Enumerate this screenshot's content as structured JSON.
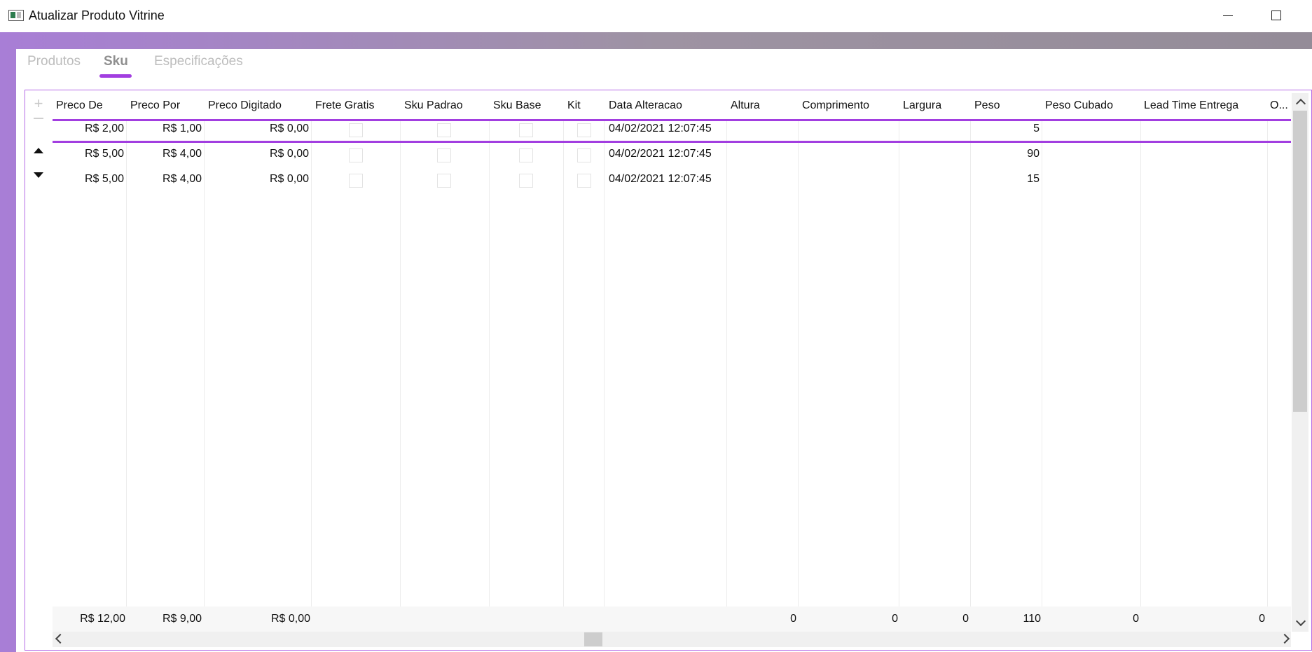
{
  "window": {
    "title": "Atualizar Produto Vitrine"
  },
  "tabs": [
    {
      "label": "Produtos",
      "active": false
    },
    {
      "label": "Sku",
      "active": true
    },
    {
      "label": "Especificações",
      "active": false
    }
  ],
  "grid": {
    "columns": [
      "Preco De",
      "Preco Por",
      "Preco Digitado",
      "Frete Gratis",
      "Sku Padrao",
      "Sku Base",
      "Kit",
      "Data Alteracao",
      "Altura",
      "Comprimento",
      "Largura",
      "Peso",
      "Peso Cubado",
      "Lead Time Entrega",
      "O..."
    ],
    "rows": [
      {
        "preco_de": "R$ 2,00",
        "preco_por": "R$ 1,00",
        "preco_digitado": "R$ 0,00",
        "frete_gratis": false,
        "sku_padrao": false,
        "sku_base": false,
        "kit": false,
        "data_alteracao": "04/02/2021 12:07:45",
        "altura": "",
        "comprimento": "",
        "largura": "",
        "peso": "5",
        "peso_cubado": "",
        "lead_time": "",
        "selected": true
      },
      {
        "preco_de": "R$ 5,00",
        "preco_por": "R$ 4,00",
        "preco_digitado": "R$ 0,00",
        "frete_gratis": false,
        "sku_padrao": false,
        "sku_base": false,
        "kit": false,
        "data_alteracao": "04/02/2021 12:07:45",
        "altura": "",
        "comprimento": "",
        "largura": "",
        "peso": "90",
        "peso_cubado": "",
        "lead_time": "",
        "selected": false
      },
      {
        "preco_de": "R$ 5,00",
        "preco_por": "R$ 4,00",
        "preco_digitado": "R$ 0,00",
        "frete_gratis": false,
        "sku_padrao": false,
        "sku_base": false,
        "kit": false,
        "data_alteracao": "04/02/2021 12:07:45",
        "altura": "",
        "comprimento": "",
        "largura": "",
        "peso": "15",
        "peso_cubado": "",
        "lead_time": "",
        "selected": false
      }
    ],
    "totals": {
      "preco_de": "R$ 12,00",
      "preco_por": "R$ 9,00",
      "preco_digitado": "R$ 0,00",
      "altura": "0",
      "comprimento": "0",
      "largura": "0",
      "peso": "110",
      "peso_cubado": "0",
      "lead_time": "0"
    },
    "controls": {
      "add": "+"
    }
  },
  "colors": {
    "accent": "#a23ee0",
    "frame_left": "#a87ed6",
    "frame_right": "#948c98"
  }
}
